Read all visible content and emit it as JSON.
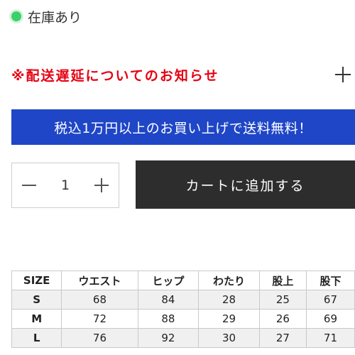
{
  "stock": {
    "label": "在庫あり",
    "status_color": "#3ccf6a"
  },
  "notice": {
    "text": "※配送遅延についてのお知らせ",
    "color": "#e60012"
  },
  "banner": {
    "text": "税込1万円以上のお買い上げで送料無料！",
    "color": "#1f46c7"
  },
  "quantity": {
    "value": "1"
  },
  "cart": {
    "button_label": "カートに追加する"
  },
  "size_table": {
    "headers": [
      "SIZE",
      "ウエスト",
      "ヒップ",
      "わたり",
      "股上",
      "股下"
    ],
    "rows": [
      [
        "S",
        "68",
        "84",
        "28",
        "25",
        "67"
      ],
      [
        "M",
        "72",
        "88",
        "29",
        "26",
        "69"
      ],
      [
        "L",
        "76",
        "92",
        "30",
        "27",
        "71"
      ]
    ]
  }
}
